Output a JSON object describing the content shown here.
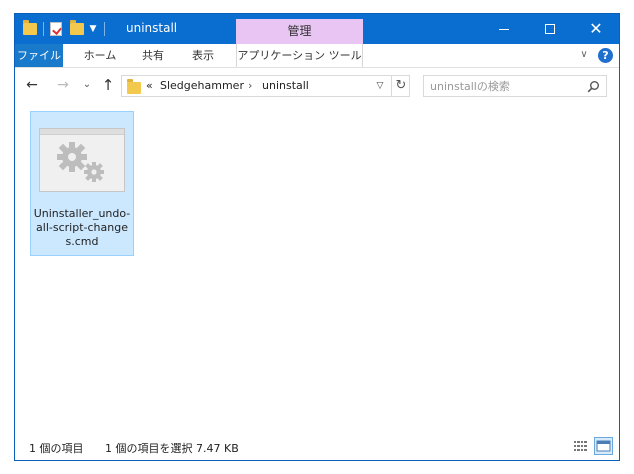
{
  "window": {
    "title": "uninstall",
    "context_tab_header": "管理",
    "colors": {
      "titlebar": "#0a6ed1",
      "context_tab": "#e8c5f2",
      "selection": "#cce8ff"
    }
  },
  "ribbon": {
    "tabs": [
      {
        "label": "ファイル",
        "active": true
      },
      {
        "label": "ホーム"
      },
      {
        "label": "共有"
      },
      {
        "label": "表示"
      },
      {
        "label": "アプリケーション ツール"
      }
    ]
  },
  "nav": {
    "breadcrumb": {
      "overflow": "«",
      "segments": [
        "Sledgehammer",
        "uninstall"
      ],
      "separator": "›"
    },
    "search": {
      "placeholder": "uninstallの検索"
    }
  },
  "files": [
    {
      "name": "Uninstaller_undo-all-script-changes.cmd",
      "icon": "cmd-script-icon",
      "selected": true
    }
  ],
  "status": {
    "item_count": "1 個の項目",
    "selection": "1 個の項目を選択  7.47 KB"
  }
}
